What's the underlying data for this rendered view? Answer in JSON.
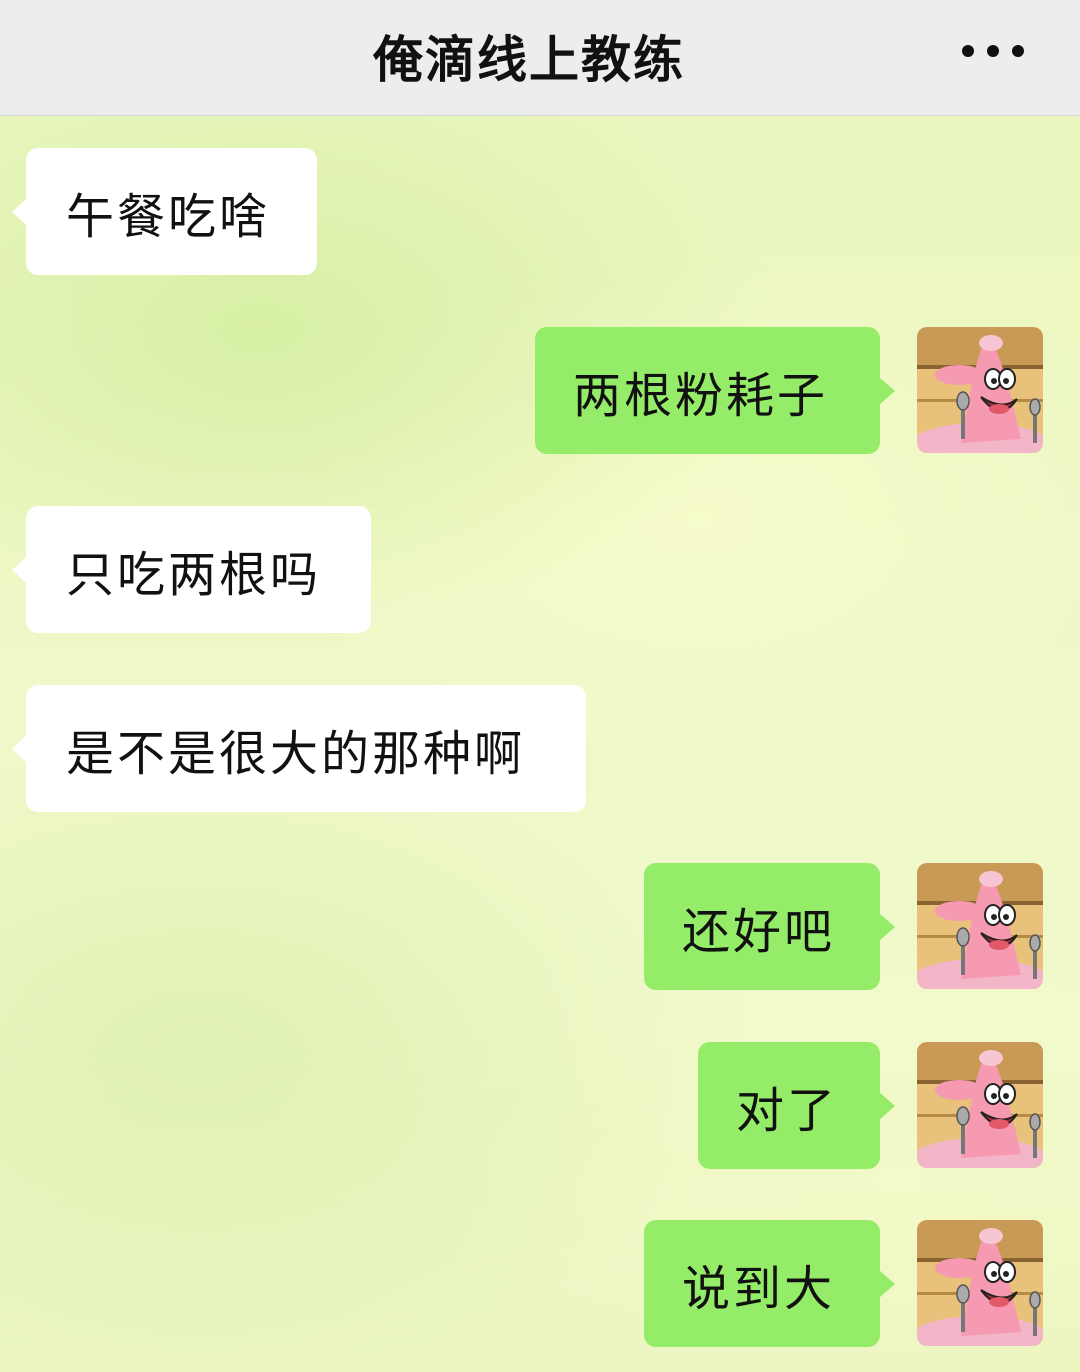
{
  "header": {
    "title": "俺滴线上教练",
    "more_icon": "more-dots-icon"
  },
  "messages": [
    {
      "side": "in",
      "text": "午餐吃啥"
    },
    {
      "side": "out",
      "text": "两根粉耗子"
    },
    {
      "side": "in",
      "text": "只吃两根吗"
    },
    {
      "side": "in",
      "text": "是不是很大的那种啊"
    },
    {
      "side": "out",
      "text": "还好吧"
    },
    {
      "side": "out",
      "text": "对了"
    },
    {
      "side": "out",
      "text": "说到大"
    }
  ],
  "colors": {
    "incoming_bubble": "#ffffff",
    "outgoing_bubble": "#95ec69",
    "header_bg": "#ededed"
  },
  "self_avatar": "cartoon-starfish-avatar"
}
